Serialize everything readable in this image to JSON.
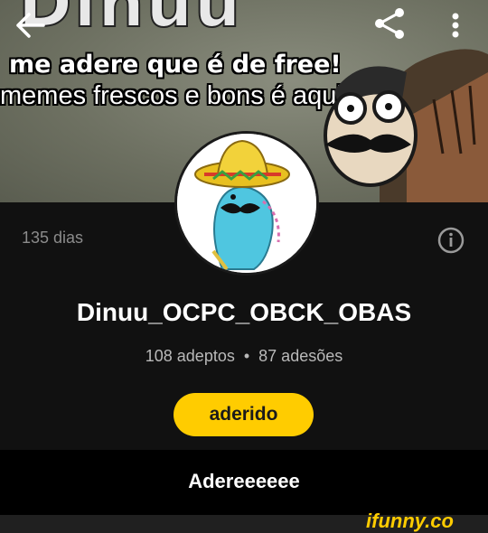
{
  "banner": {
    "caption_line1": "me adere que é de free!",
    "caption_line2": "memes frescos e bons é aqui"
  },
  "toolbar": {
    "back_icon": "arrow-left-icon",
    "share_icon": "share-icon",
    "more_icon": "more-vertical-icon"
  },
  "profile": {
    "days": "135 dias",
    "username": "Dinuu_OCPC_OBCK_OBAS",
    "followers": "108 adeptos",
    "separator": "•",
    "joins": "87 adesões",
    "join_button_label": "aderido",
    "bio": "Adereeeeee"
  },
  "watermark": "ifunny.co",
  "colors": {
    "accent": "#ffcc00",
    "background": "#111111",
    "bio_band": "#000000"
  }
}
